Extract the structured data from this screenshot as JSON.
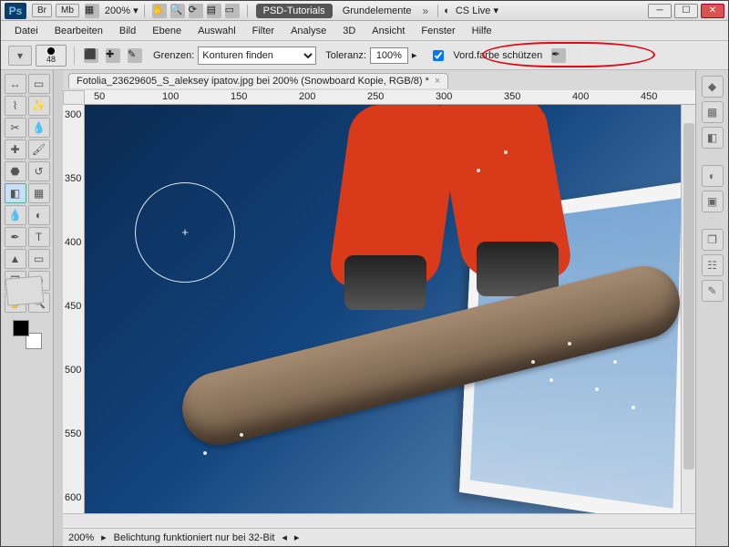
{
  "titlebar": {
    "zoom": "200%",
    "tut_label": "PSD-Tutorials",
    "grund_label": "Grundelemente",
    "cslive": "CS Live"
  },
  "menu": [
    "Datei",
    "Bearbeiten",
    "Bild",
    "Ebene",
    "Auswahl",
    "Filter",
    "Analyse",
    "3D",
    "Ansicht",
    "Fenster",
    "Hilfe"
  ],
  "options": {
    "brush_size": "48",
    "grenzen_label": "Grenzen:",
    "grenzen_value": "Konturen finden",
    "toleranz_label": "Toleranz:",
    "toleranz_value": "100%",
    "vordfarbe_label": "Vord.farbe schützen",
    "vordfarbe_checked": true
  },
  "document": {
    "tab_title": "Fotolia_23629605_S_aleksey ipatov.jpg bei 200% (Snowboard Kopie, RGB/8) *"
  },
  "ruler_h": [
    "50",
    "100",
    "150",
    "200",
    "250",
    "300",
    "350",
    "400",
    "450"
  ],
  "ruler_v": [
    "300",
    "350",
    "400",
    "450",
    "500",
    "550",
    "600"
  ],
  "status": {
    "zoom": "200%",
    "msg": "Belichtung funktioniert nur bei 32-Bit"
  },
  "icons": {
    "br": "Br",
    "mb": "Mb",
    "mini": "─",
    "max": "☐",
    "close": "✕"
  }
}
